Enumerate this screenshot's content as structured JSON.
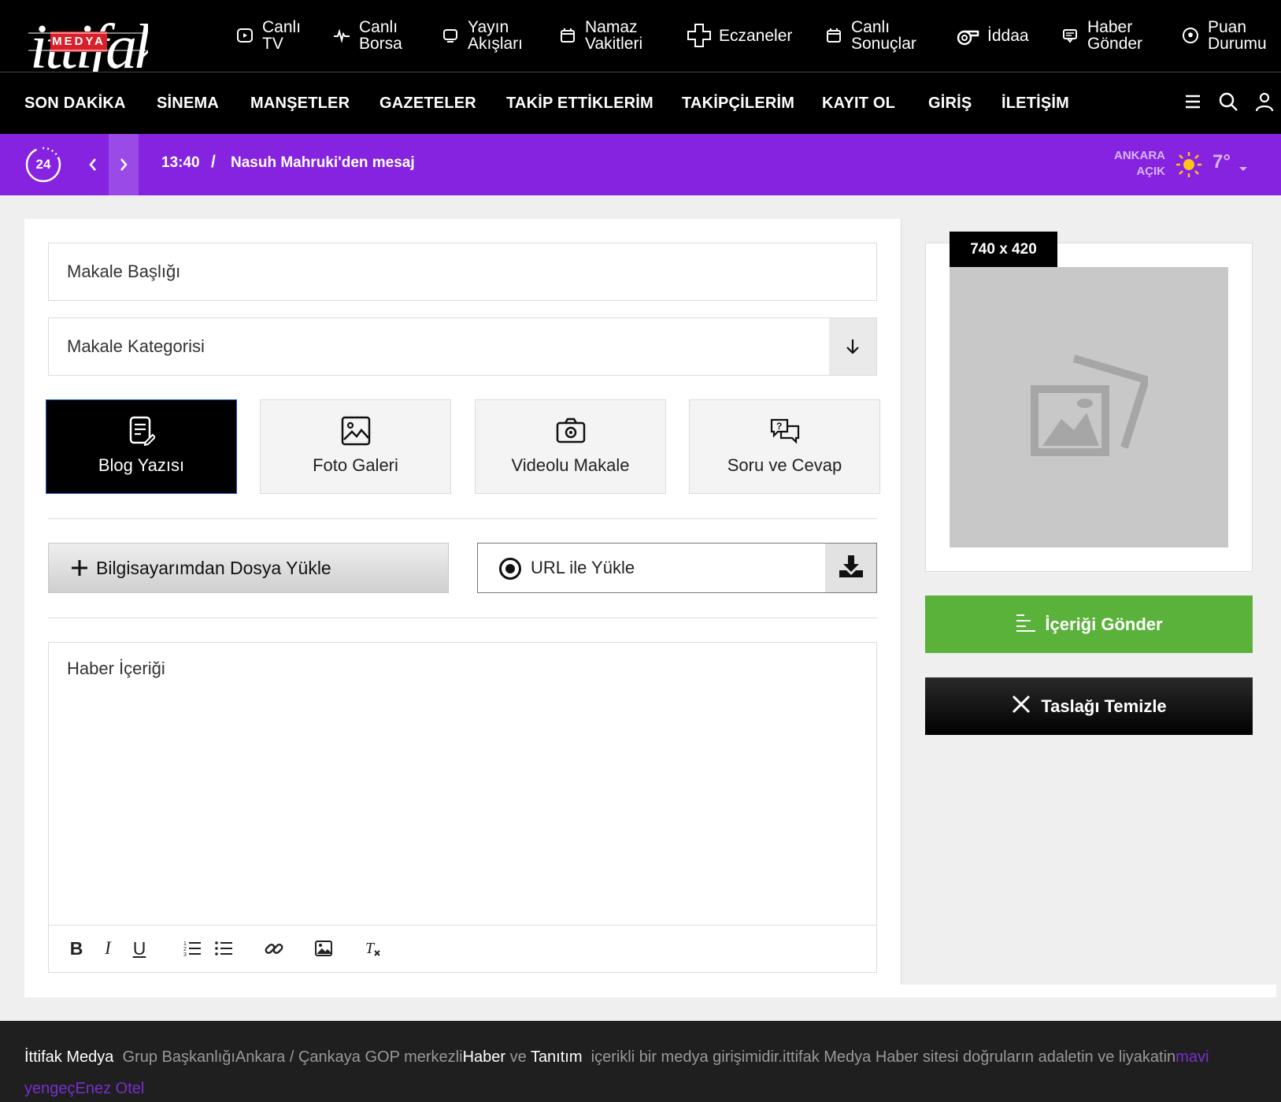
{
  "header": {
    "logo_word": "ittifak",
    "logo_badge": "MEDYA",
    "quick_links": [
      {
        "line1": "Canlı",
        "line2": "TV",
        "icon": "play-square-icon"
      },
      {
        "line1": "Canlı",
        "line2": "Borsa",
        "icon": "pulse-icon"
      },
      {
        "line1": "Yayın",
        "line2": "Akışları",
        "icon": "tv-icon"
      },
      {
        "line1": "Namaz",
        "line2": "Vakitleri",
        "icon": "calendar-icon"
      },
      {
        "line1": "Eczaneler",
        "line2": "",
        "icon": "pharmacy-cross-icon"
      },
      {
        "line1": "Canlı",
        "line2": "Sonuçlar",
        "icon": "calendar-icon"
      },
      {
        "line1": "İddaa",
        "line2": "",
        "icon": "whistle-icon"
      },
      {
        "line1": "Haber",
        "line2": "Gönder",
        "icon": "message-icon"
      },
      {
        "line1": "Puan",
        "line2": "Durumu",
        "icon": "football-icon"
      }
    ]
  },
  "nav": {
    "links": [
      "SON DAKİKA",
      "SİNEMA",
      "MANŞETLER",
      "GAZETELER",
      "TAKİP ETTİKLERİM",
      "TAKİPÇİLERİM",
      "KAYIT OL",
      "GİRİŞ",
      "İLETİŞİM"
    ]
  },
  "ticker": {
    "badge": "24",
    "time": "13:40",
    "separator": "/",
    "headline": "Nasuh Mahruki'den mesaj",
    "weather": {
      "city": "ANKARA",
      "condition": "AÇIK",
      "temp": "7°"
    }
  },
  "form": {
    "title_placeholder": "Makale Başlığı",
    "category_placeholder": "Makale Kategorisi",
    "types": [
      {
        "label": "Blog Yazısı",
        "icon": "blog-edit-icon",
        "active": true
      },
      {
        "label": "Foto Galeri",
        "icon": "image-icon",
        "active": false
      },
      {
        "label": "Videolu Makale",
        "icon": "camera-icon",
        "active": false
      },
      {
        "label": "Soru ve Cevap",
        "icon": "question-chat-icon",
        "active": false
      }
    ],
    "upload_label": "Bilgisayarımdan Dosya Yükle",
    "url_label": "URL ile Yükle",
    "content_placeholder": "Haber İçeriği",
    "toolbar": [
      "B",
      "I",
      "U"
    ]
  },
  "sidebar": {
    "image_size": "740 x 420",
    "send_label": "İçeriği Gönder",
    "clear_label": "Taslağı Temizle"
  },
  "footer": {
    "brand": "İttifak Medya",
    "text1": "Grup BaşkanlığıAnkara / Çankaya GOP merkezli",
    "w1": "Haber",
    "text2": "ve",
    "w2": "Tanıtım",
    "text3": "içerikli bir medya girişimidir.ittifak Medya Haber sitesi doğruların adaletin ve liyakatin",
    "link1": "mavi yengeç",
    "link2": "Enez Otel"
  },
  "colors": {
    "accent_purple": "#8523e0",
    "send_green": "#5ab23a"
  }
}
